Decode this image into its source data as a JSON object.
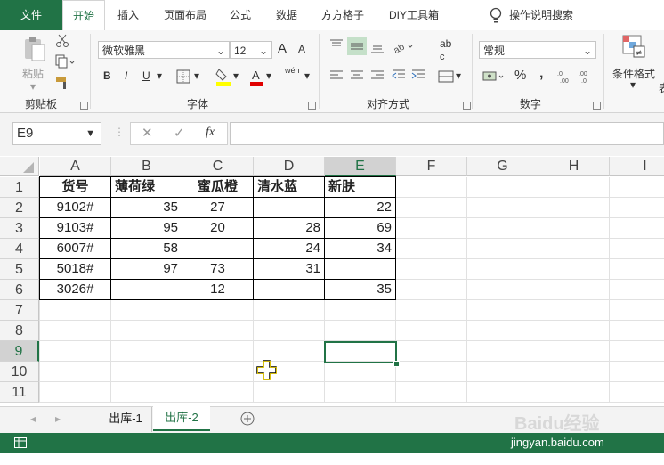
{
  "tabs": [
    "文件",
    "开始",
    "插入",
    "页面布局",
    "公式",
    "数据",
    "方方格子",
    "DIY工具箱"
  ],
  "tell_me": "操作说明搜索",
  "ribbon": {
    "clipboard": {
      "paste": "粘贴",
      "label": "剪贴板"
    },
    "font": {
      "name": "微软雅黑",
      "size": "12",
      "label": "字体",
      "grow": "A",
      "shrink": "A",
      "bold": "B",
      "italic": "I",
      "underline": "U",
      "phonetic": "wén"
    },
    "alignment": {
      "label": "对齐方式",
      "wrap_icon": "ab",
      "wrap_sub": "c"
    },
    "number": {
      "format": "常规",
      "label": "数字",
      "percent": "%",
      "comma": ","
    },
    "styles": {
      "conditional": "条件格式",
      "cut_off": "表"
    }
  },
  "formula_bar": {
    "name_box": "E9",
    "fx": "fx",
    "cancel": "✕",
    "enter": "✓",
    "formula": ""
  },
  "columns": [
    "A",
    "B",
    "C",
    "D",
    "E",
    "F",
    "G",
    "H",
    "I"
  ],
  "rows": [
    "1",
    "2",
    "3",
    "4",
    "5",
    "6",
    "7",
    "8",
    "9",
    "10",
    "11"
  ],
  "table": {
    "headers": [
      "货号",
      "薄荷绿",
      "蜜瓜橙",
      "清水蓝",
      "新肤"
    ],
    "data": [
      [
        "9102#",
        "35",
        "27",
        "",
        "22"
      ],
      [
        "9103#",
        "95",
        "20",
        "28",
        "69"
      ],
      [
        "6007#",
        "58",
        "",
        "24",
        "34"
      ],
      [
        "5018#",
        "97",
        "73",
        "31",
        ""
      ],
      [
        "3026#",
        "",
        "12",
        "",
        "35"
      ]
    ]
  },
  "active_cell": "E9",
  "sheets": [
    "出库-1",
    "出库-2"
  ],
  "active_sheet": "出库-2",
  "watermark": {
    "brand": "Baidu经验",
    "url": "jingyan.baidu.com"
  },
  "colors": {
    "excel_green": "#217346",
    "selection": "#217346"
  }
}
